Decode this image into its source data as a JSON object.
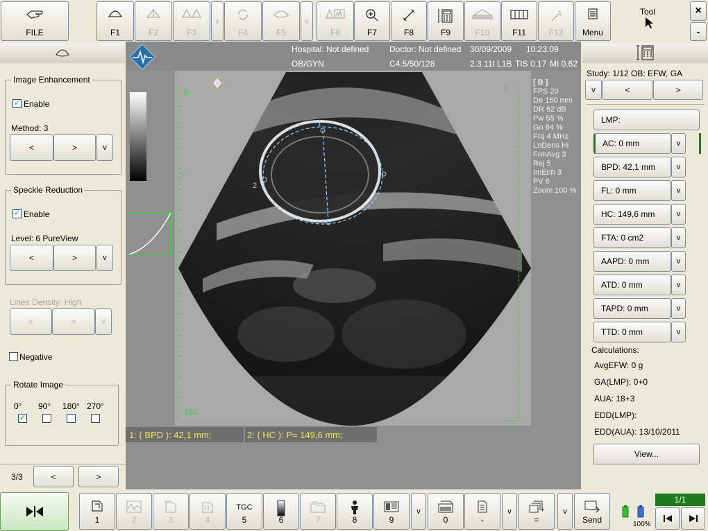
{
  "toolbar": {
    "file": "FILE",
    "f1": "F1",
    "f2": "F2",
    "f3": "F3",
    "f4": "F4",
    "f5": "F5",
    "f6": "F6",
    "f7": "F7",
    "f8": "F8",
    "f9": "F9",
    "f10": "F10",
    "f11": "F11",
    "f12": "F12",
    "v": "v",
    "menu": "Menu",
    "tool": "Tool",
    "close": "×",
    "minimize": "-"
  },
  "header": {
    "hospital": "Hospital: Not defined",
    "doctor": "Doctor: Not defined",
    "date": "30/09/2009",
    "time": "10:23:09",
    "dept": "OB/GYN",
    "probe": "C4.5/50/128",
    "version": "2.3.11t L1B",
    "tis": "TIS 0,17",
    "mi": "MI 0,62"
  },
  "left": {
    "image_enhancement": {
      "title": "Image Enhancement",
      "enable": "Enable",
      "enabled": true,
      "method": "Method: 3"
    },
    "speckle": {
      "title": "Speckle Reduction",
      "enable": "Enable",
      "enabled": true,
      "level": "Level: 6 PureView"
    },
    "lines_density": "Lines Density: High",
    "negative": "Negative",
    "rotate": {
      "title": "Rotate Image",
      "options": [
        "0°",
        "90°",
        "180°",
        "270°"
      ],
      "selected": "0°"
    },
    "prev": "<",
    "next": ">",
    "v": "v",
    "page": "3/3"
  },
  "image": {
    "overlay": {
      "mode": "[ B ]",
      "lines": [
        "FPS  20",
        "De   150 mm",
        "DR   62 dB",
        "Pw   55 %",
        "Gn   84 %",
        "Frq   4 MHz",
        "LnDens  Hi",
        "FrmAvg   3",
        "Rej   5",
        "ImEnh   3",
        "PV   6",
        "Zoom   100 %"
      ]
    },
    "depth_top": "0",
    "depth_bottom": "150",
    "caliper1": "1",
    "caliper2": "2",
    "measure1": "1:    ( BPD ): 42,1 mm;",
    "measure2": "2:    ( HC ): P= 149,6 mm;"
  },
  "right": {
    "study": "Study:  1/12 OB: EFW, GA",
    "v": "v",
    "prev": "<",
    "next": ">",
    "lmp": "LMP:",
    "measurements": [
      {
        "label": "AC: 0 mm",
        "key": "A"
      },
      {
        "label": "BPD: 42,1 mm",
        "key": "B"
      },
      {
        "label": "FL: 0 mm",
        "key": "F"
      },
      {
        "label": "HC: 149,6 mm",
        "key": "H"
      },
      {
        "label": "FTA: 0  cm2",
        "key": ""
      },
      {
        "label": "AAPD: 0 mm",
        "key": ""
      },
      {
        "label": "ATD: 0 mm",
        "key": ""
      },
      {
        "label": "TAPD: 0 mm",
        "key": ""
      },
      {
        "label": "TTD: 0 mm",
        "key": ""
      }
    ],
    "calculations": "Calculations:",
    "calc": [
      "AvgEFW: 0  g",
      "GA(LMP): 0+0",
      "AUA: 18+3",
      "EDD(LMP):",
      "EDD(AUA): 13/10/2011"
    ],
    "view": "View..."
  },
  "bottom": {
    "b1": "1",
    "b2": "2",
    "b3": "3",
    "b4": "4",
    "tgc": "TGC",
    "b5": "5",
    "b6": "6",
    "b7": "7",
    "b8": "8",
    "b9": "9",
    "b0": "0",
    "dash": "-",
    "eq": "=",
    "send": "Send",
    "v": "v",
    "battery": "100%",
    "page": "1/1"
  },
  "colors": {
    "accent_green": "#1e7a1e",
    "caliper": "#8fd0ff",
    "measure_text": "#f4e25a"
  }
}
